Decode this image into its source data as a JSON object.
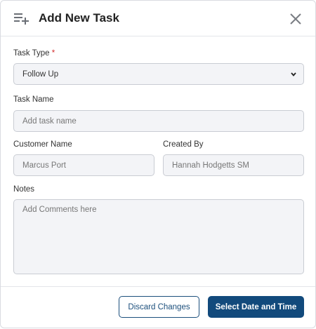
{
  "header": {
    "title": "Add New Task",
    "icon": "playlist-add-icon",
    "close_icon": "close-icon"
  },
  "form": {
    "task_type": {
      "label": "Task Type",
      "required_mark": "*",
      "value": "Follow Up"
    },
    "task_name": {
      "label": "Task Name",
      "placeholder": "Add task name"
    },
    "customer_name": {
      "label": "Customer Name",
      "value": "Marcus Port"
    },
    "created_by": {
      "label": "Created By",
      "value": "Hannah Hodgetts SM"
    },
    "notes": {
      "label": "Notes",
      "placeholder": "Add Comments here"
    }
  },
  "footer": {
    "discard_label": "Discard Changes",
    "primary_label": "Select Date and Time"
  },
  "colors": {
    "primary": "#124a7c",
    "required": "#d32f2f",
    "field_bg": "#f3f4f7"
  }
}
